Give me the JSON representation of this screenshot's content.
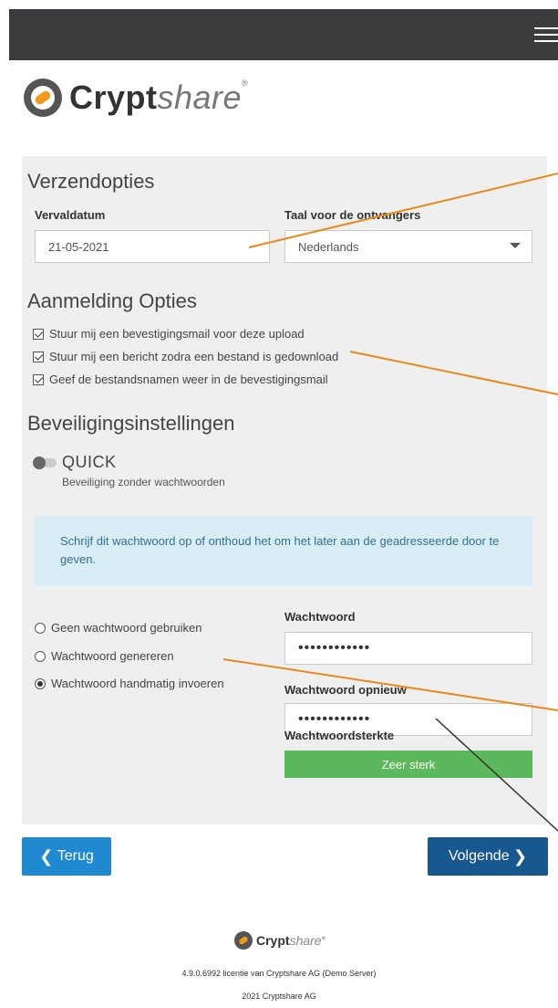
{
  "header": {
    "menu_icon": "hamburger-icon"
  },
  "brand": {
    "name_bold": "Crypt",
    "name_light": "share",
    "registered": "®",
    "logo_icon": "cryptshare-logo-icon"
  },
  "send_options": {
    "title": "Verzendopties",
    "expiry_label": "Vervaldatum",
    "expiry_value": "21-05-2021",
    "language_label": "Taal voor de ontvangers",
    "language_value": "Nederlands"
  },
  "notification": {
    "title": "Aanmelding Opties",
    "options": [
      {
        "label": "Stuur mij een bevestigingsmail voor deze upload",
        "checked": true
      },
      {
        "label": "Stuur mij een bericht zodra een bestand is gedownload",
        "checked": true
      },
      {
        "label": "Geef de bestandsnamen weer in de bevestigingsmail",
        "checked": true
      }
    ]
  },
  "security": {
    "title": "Beveiligingsinstellingen",
    "mode": "QUICK",
    "mode_sub": "Beveiliging zonder wachtwoorden",
    "info": "Schrijf dit wachtwoord op of onthoud het om het later aan de geadresseerde door te geven.",
    "radio": [
      {
        "label": "Geen wachtwoord gebruiken",
        "selected": false
      },
      {
        "label": "Wachtwoord genereren",
        "selected": false
      },
      {
        "label": "Wachtwoord handmatig invoeren",
        "selected": true
      }
    ],
    "password_label": "Wachtwoord",
    "password_value": "••••••••••••",
    "password_repeat_label": "Wachtwoord opnieuw",
    "password_repeat_value": "••••••••••••",
    "strength_label": "Wachtwoordsterkte",
    "strength_value": "Zeer sterk",
    "strength_color": "#5cb85c"
  },
  "nav": {
    "back": "Terug",
    "next": "Volgende"
  },
  "footer": {
    "license": "4.9.0.6992 licentie van Cryptshare AG (Demo Server)",
    "copyright": "2021 Cryptshare AG"
  },
  "colors": {
    "topbar": "#3b3b3d",
    "primary": "#1f8ad0",
    "primary_dark": "#17588f",
    "info_bg": "#d9edf7",
    "annotation": "#e8891b"
  }
}
